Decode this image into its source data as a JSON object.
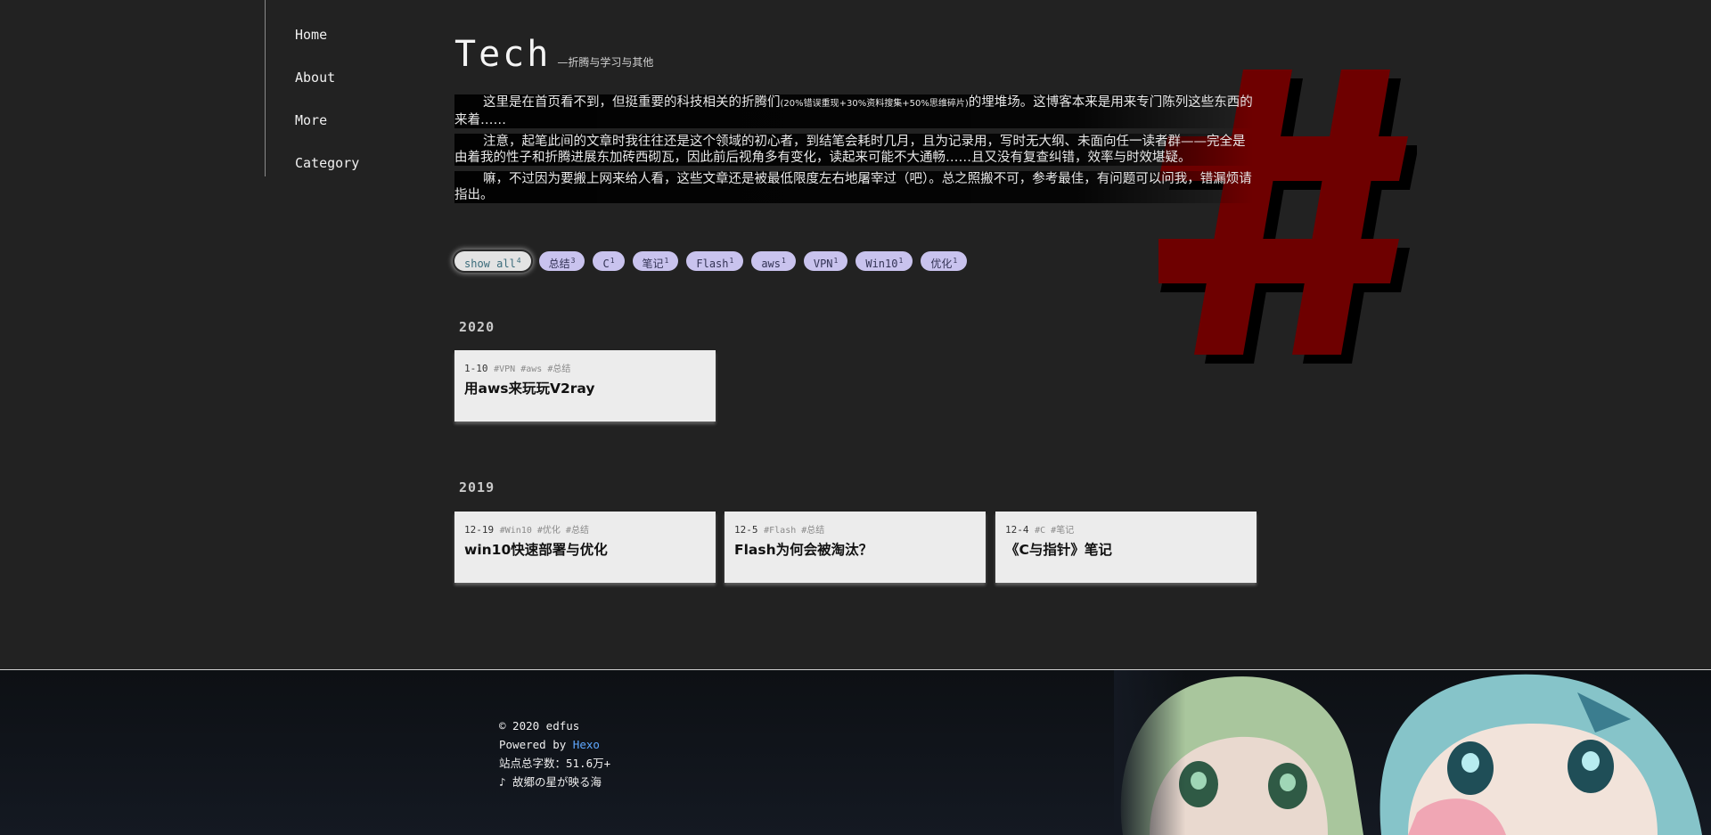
{
  "nav": {
    "items": [
      {
        "label": "Home"
      },
      {
        "label": "About"
      },
      {
        "label": "More"
      },
      {
        "label": "Category"
      }
    ]
  },
  "header": {
    "title": "Tech",
    "subtitle": "—折腾与学习与其他"
  },
  "intro": {
    "p1_a": "这里是在首页看不到，但挺重要的科技相关的折腾们",
    "p1_small": "(20%错误重现+30%资料搜集+50%思维碎片)",
    "p1_b": "的埋堆场。这博客本来是用来专门陈列这些东西的来着……",
    "p2": "注意，起笔此间的文章时我往往还是这个领域的初心者，到结笔会耗时几月，且为记录用，写时无大纲、未面向任一读者群——完全是由着我的性子和折腾进展东加砖西砌瓦，因此前后视角多有变化，读起来可能不大通畅……且又没有复查纠错，效率与时效堪疑。",
    "p3": "嘛，不过因为要搬上网来给人看，这些文章还是被最低限度左右地屠宰过（吧）。总之照搬不可，参考最佳，有问题可以问我，错漏烦请指出。"
  },
  "tags": [
    {
      "label": "show all",
      "count": "4",
      "active": true
    },
    {
      "label": "总结",
      "count": "3"
    },
    {
      "label": "C",
      "count": "1"
    },
    {
      "label": "笔记",
      "count": "1"
    },
    {
      "label": "Flash",
      "count": "1"
    },
    {
      "label": "aws",
      "count": "1"
    },
    {
      "label": "VPN",
      "count": "1"
    },
    {
      "label": "Win10",
      "count": "1"
    },
    {
      "label": "优化",
      "count": "1"
    }
  ],
  "years": [
    {
      "year": "2020",
      "posts": [
        {
          "date": "1-10",
          "tags": "#VPN #aws #总结",
          "title": "用aws来玩玩V2ray"
        }
      ]
    },
    {
      "year": "2019",
      "posts": [
        {
          "date": "12-19",
          "tags": "#Win10 #优化 #总结",
          "title": "win10快速部署与优化"
        },
        {
          "date": "12-5",
          "tags": "#Flash #总结",
          "title": "Flash为何会被淘汰？"
        },
        {
          "date": "12-4",
          "tags": "#C #笔记",
          "title": "《C与指针》笔记"
        }
      ]
    }
  ],
  "footer": {
    "copyright": "© 2020 edfus",
    "powered_prefix": "Powered by ",
    "powered_link": "Hexo",
    "wordcount": "站点总字数：51.6万+",
    "music": "♪ 故郷の星が映る海"
  },
  "colors": {
    "background": "#222222",
    "hash": "#6e0000",
    "tag": "#c9c3ee",
    "link": "#5fa8ff"
  }
}
